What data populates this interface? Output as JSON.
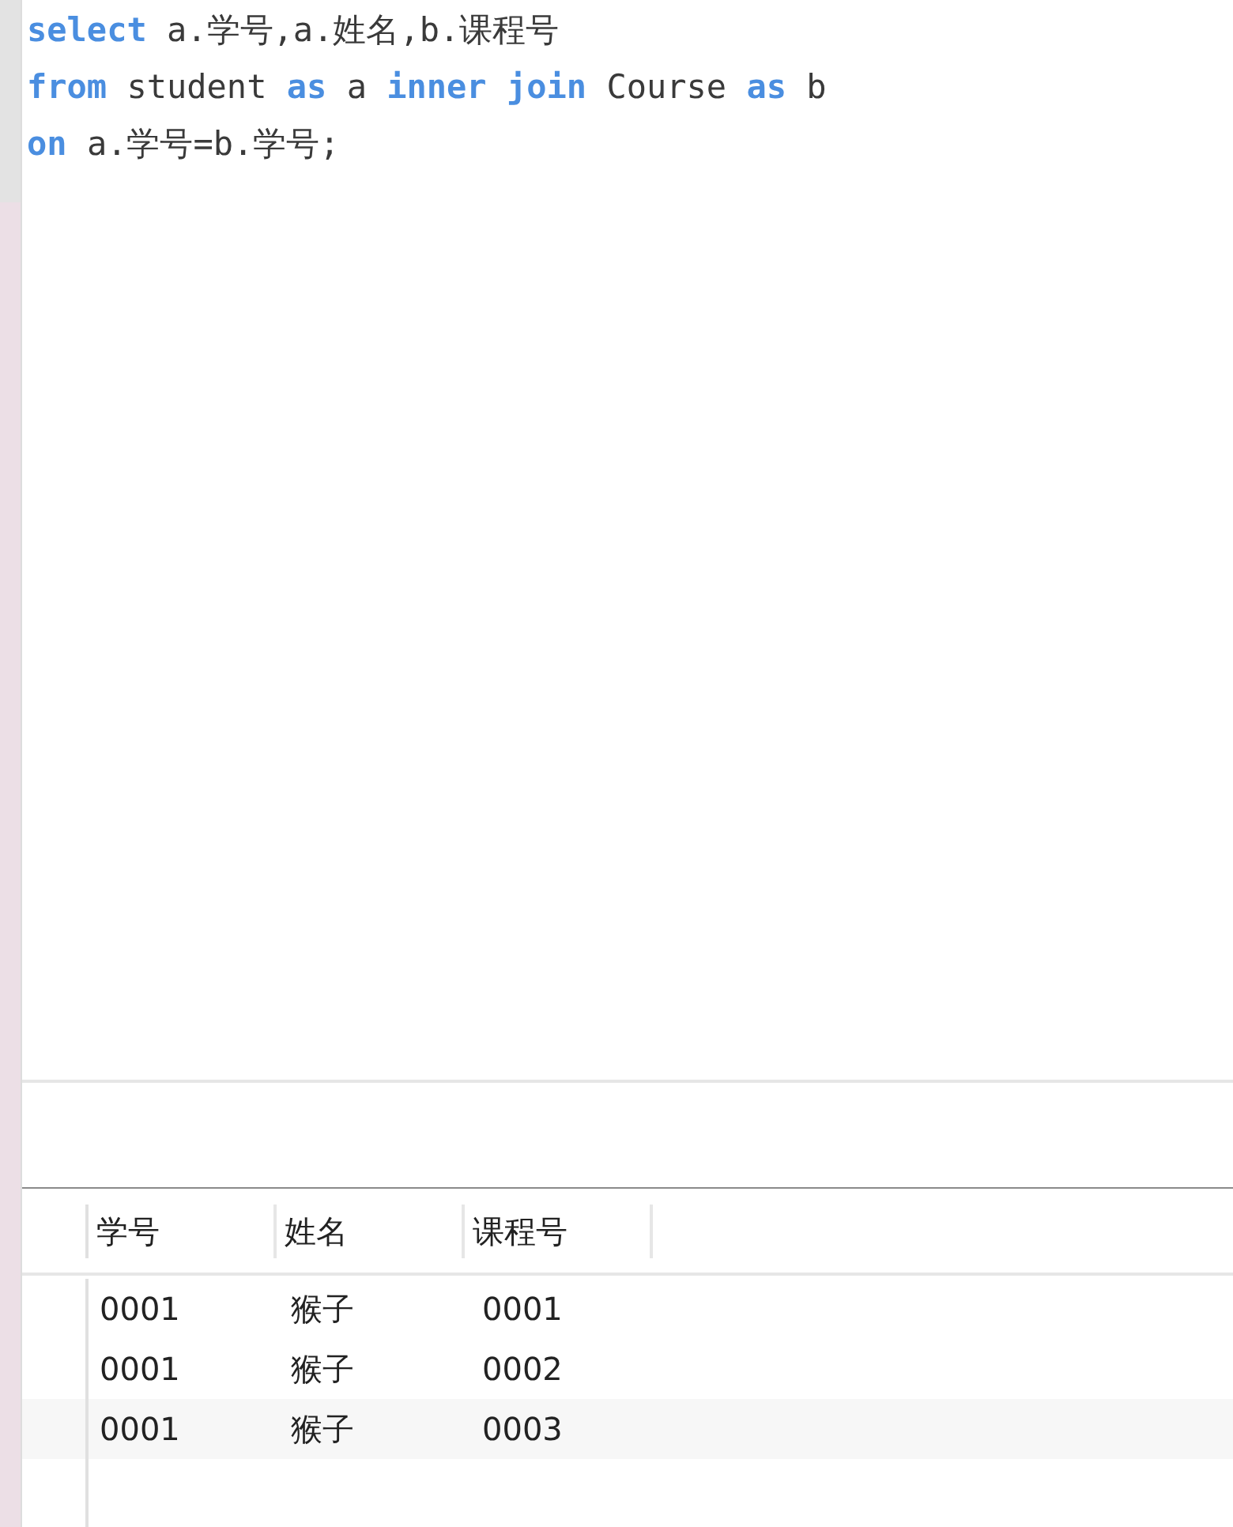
{
  "editor": {
    "lines": [
      [
        {
          "kind": "keyword",
          "text": "select"
        },
        {
          "kind": "plain",
          "text": " a.学号,a.姓名,b.课程号"
        }
      ],
      [
        {
          "kind": "keyword",
          "text": "from"
        },
        {
          "kind": "plain",
          "text": " student "
        },
        {
          "kind": "keyword",
          "text": "as"
        },
        {
          "kind": "plain",
          "text": " a "
        },
        {
          "kind": "keyword",
          "text": "inner join"
        },
        {
          "kind": "plain",
          "text": " Course "
        },
        {
          "kind": "keyword",
          "text": "as"
        },
        {
          "kind": "plain",
          "text": " b"
        }
      ],
      [
        {
          "kind": "keyword",
          "text": "on"
        },
        {
          "kind": "plain",
          "text": " a.学号=b.学号;"
        }
      ]
    ]
  },
  "result_table": {
    "columns": [
      "学号",
      "姓名",
      "课程号"
    ],
    "rows": [
      [
        "0001",
        "猴子",
        "0001"
      ],
      [
        "0001",
        "猴子",
        "0002"
      ],
      [
        "0001",
        "猴子",
        "0003"
      ]
    ]
  }
}
